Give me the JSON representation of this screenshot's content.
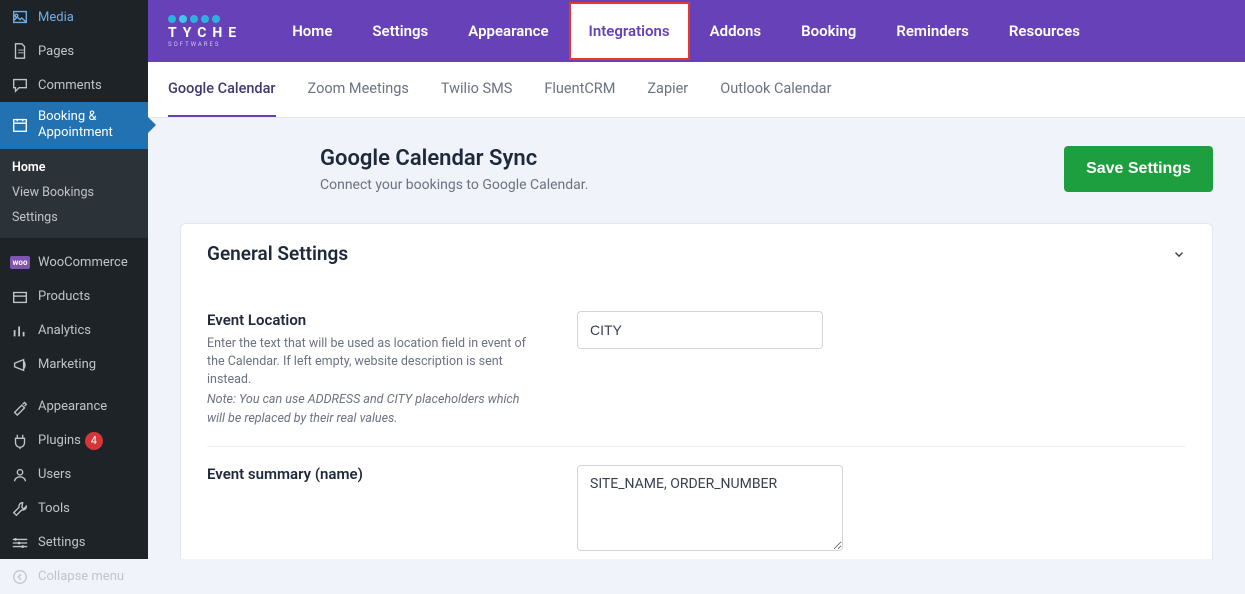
{
  "colors": {
    "accent": "#6741b8",
    "save": "#1d9e3f",
    "highlight": "#e23b2e",
    "wp_active": "#2271b1"
  },
  "sidebar": {
    "items": [
      {
        "icon": "media-icon",
        "label": "Media"
      },
      {
        "icon": "page-icon",
        "label": "Pages"
      },
      {
        "icon": "comment-icon",
        "label": "Comments"
      },
      {
        "icon": "calendar-icon",
        "label": "Booking & Appointment",
        "active": true
      },
      {
        "icon": "woo-icon",
        "label": "WooCommerce"
      },
      {
        "icon": "products-icon",
        "label": "Products"
      },
      {
        "icon": "analytics-icon",
        "label": "Analytics"
      },
      {
        "icon": "marketing-icon",
        "label": "Marketing"
      },
      {
        "icon": "appearance-icon",
        "label": "Appearance"
      },
      {
        "icon": "plugins-icon",
        "label": "Plugins",
        "badge": "4"
      },
      {
        "icon": "users-icon",
        "label": "Users"
      },
      {
        "icon": "tools-icon",
        "label": "Tools"
      },
      {
        "icon": "settings-icon",
        "label": "Settings"
      },
      {
        "icon": "collapse-icon",
        "label": "Collapse menu"
      }
    ],
    "sub": [
      {
        "label": "Home",
        "active": true
      },
      {
        "label": "View Bookings"
      },
      {
        "label": "Settings"
      }
    ]
  },
  "logo": {
    "name": "TYCHE",
    "tagline": "SOFTWARES"
  },
  "nav": [
    {
      "label": "Home"
    },
    {
      "label": "Settings"
    },
    {
      "label": "Appearance"
    },
    {
      "label": "Integrations",
      "active": true
    },
    {
      "label": "Addons"
    },
    {
      "label": "Booking"
    },
    {
      "label": "Reminders"
    },
    {
      "label": "Resources"
    }
  ],
  "subtabs": [
    {
      "label": "Google Calendar",
      "active": true
    },
    {
      "label": "Zoom Meetings"
    },
    {
      "label": "Twilio SMS"
    },
    {
      "label": "FluentCRM"
    },
    {
      "label": "Zapier"
    },
    {
      "label": "Outlook Calendar"
    }
  ],
  "page": {
    "title": "Google Calendar Sync",
    "desc": "Connect your bookings to Google Calendar.",
    "save_label": "Save Settings"
  },
  "panel": {
    "title": "General Settings",
    "fields": {
      "event_location": {
        "label": "Event Location",
        "help": "Enter the text that will be used as location field in event of the Calendar. If left empty, website description is sent instead.",
        "note": "Note: You can use ADDRESS and CITY placeholders which will be replaced by their real values.",
        "value": "CITY"
      },
      "event_summary": {
        "label": "Event summary (name)",
        "value": "SITE_NAME, ORDER_NUMBER"
      }
    }
  }
}
